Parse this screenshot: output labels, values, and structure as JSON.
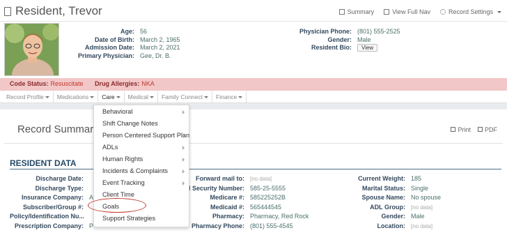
{
  "header": {
    "title": "Resident, Trevor",
    "actions": [
      {
        "label": "Summary",
        "icon": "grid-icon"
      },
      {
        "label": "View Full Nav",
        "icon": "nav-icon"
      },
      {
        "label": "Record Settings",
        "icon": "gear-icon"
      }
    ]
  },
  "resident_info": {
    "left": [
      {
        "label": "Age:",
        "value": "56"
      },
      {
        "label": "Date of Birth:",
        "value": "March 2, 1965"
      },
      {
        "label": "Admission Date:",
        "value": "March 2, 2021"
      },
      {
        "label": "Primary Physician:",
        "value": "Gee, Dr. B."
      }
    ],
    "right": [
      {
        "label": "Physician Phone:",
        "value": "(801) 555-2525"
      },
      {
        "label": "Gender:",
        "value": "Male"
      },
      {
        "label": "Resident Bio:",
        "value": "View"
      }
    ]
  },
  "alert": {
    "code_status_label": "Code Status:",
    "code_status_value": "Resuscitate",
    "drug_allergies_label": "Drug Allergies:",
    "drug_allergies_value": "NKA"
  },
  "nav": [
    {
      "label": "Record Profile"
    },
    {
      "label": "Medications"
    },
    {
      "label": "Care"
    },
    {
      "label": "Medical"
    },
    {
      "label": "Family Connect"
    },
    {
      "label": "Finance"
    }
  ],
  "care_menu": [
    {
      "label": "Behavioral",
      "submenu": true
    },
    {
      "label": "Shift Change Notes",
      "submenu": false
    },
    {
      "label": "Person Centered Support Plan",
      "submenu": true
    },
    {
      "label": "ADLs",
      "submenu": true
    },
    {
      "label": "Human Rights",
      "submenu": true
    },
    {
      "label": "Incidents & Complaints",
      "submenu": true
    },
    {
      "label": "Event Tracking",
      "submenu": true
    },
    {
      "label": "Client Time",
      "submenu": false
    },
    {
      "label": "Goals",
      "submenu": false
    },
    {
      "label": "Support Strategies",
      "submenu": false
    }
  ],
  "record_summary": {
    "title": "Record Summary",
    "print_label": "Print",
    "pdf_label": "PDF"
  },
  "resident_data": {
    "section_title": "RESIDENT DATA",
    "col1": [
      {
        "label": "Discharge Date:",
        "value": ""
      },
      {
        "label": "Discharge Type:",
        "value": ""
      },
      {
        "label": "Insurance Company:",
        "value": "A"
      },
      {
        "label": "Subscriber/Group #:",
        "value": ""
      },
      {
        "label": "Policy/Identification Nu...",
        "value": ""
      },
      {
        "label": "Prescription Company:",
        "value": "P"
      }
    ],
    "col2": [
      {
        "label": "Forward mail to:",
        "value": "[no data]",
        "nodata": true
      },
      {
        "label": "cial Security Number:",
        "value": "585-25-5555"
      },
      {
        "label": "Medicare #:",
        "value": "585225252B"
      },
      {
        "label": "Medicaid #:",
        "value": "565444545"
      },
      {
        "label": "Pharmacy:",
        "value": "Pharmacy, Red Rock"
      },
      {
        "label": "Pharmacy Phone:",
        "value": "(801) 555-4545"
      }
    ],
    "col3": [
      {
        "label": "Current Weight:",
        "value": "185"
      },
      {
        "label": "Marital Status:",
        "value": "Single"
      },
      {
        "label": "Spouse Name:",
        "value": "No spouse"
      },
      {
        "label": "ADL Group:",
        "value": "[no data]",
        "nodata": true
      },
      {
        "label": "Gender:",
        "value": "Male"
      },
      {
        "label": "Location:",
        "value": "[no data]",
        "nodata": true
      }
    ]
  }
}
